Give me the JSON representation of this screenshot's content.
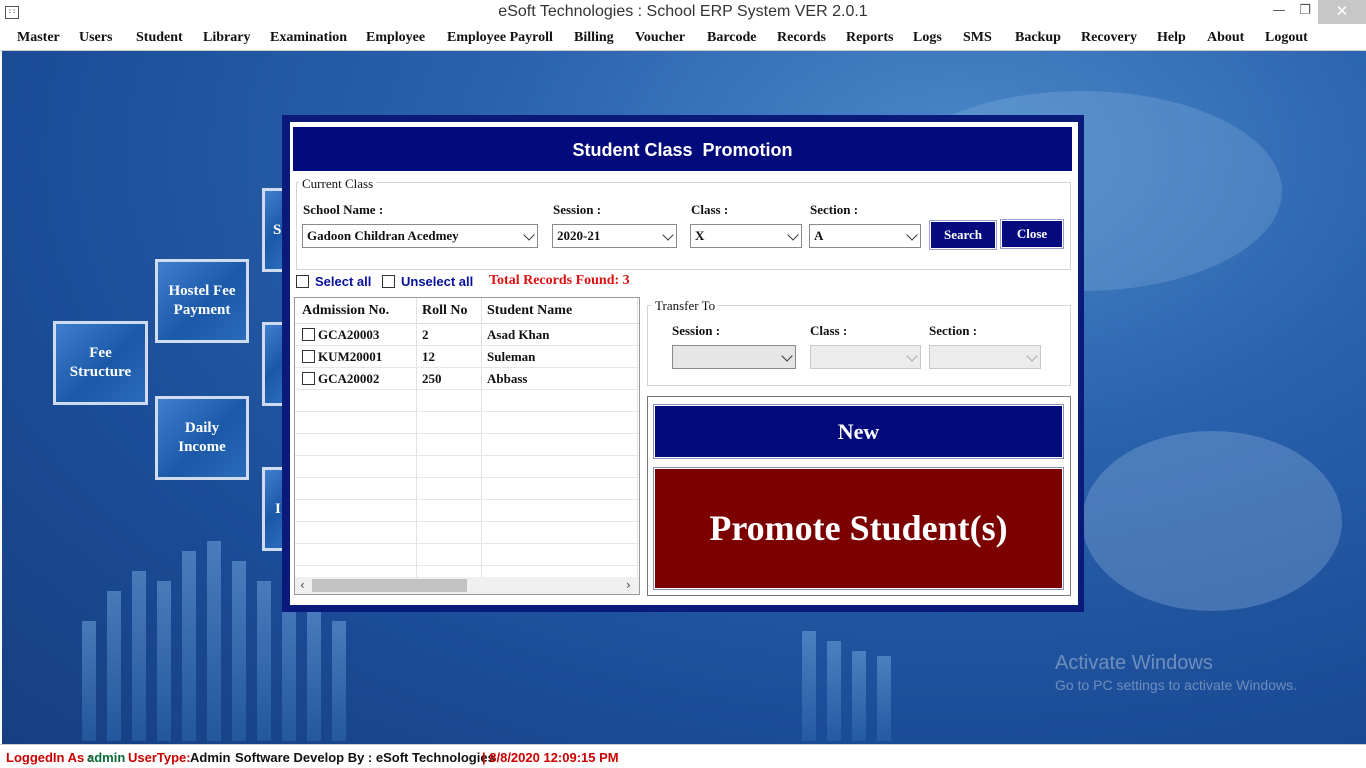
{
  "window": {
    "title": "eSoft Technologies : School ERP System VER 2.0.1",
    "icon": "app-icon",
    "min_glyph": "—",
    "max_glyph": "❐",
    "close_glyph": "✕"
  },
  "menu": [
    "Master",
    "Users",
    "Student",
    "Library",
    "Examination",
    "Employee",
    "Employee Payroll",
    "Billing",
    "Voucher",
    "Barcode",
    "Records",
    "Reports",
    "Logs",
    "SMS",
    "Backup",
    "Recovery",
    "Help",
    "About",
    "Logout"
  ],
  "tiles": {
    "hostel_fee": "Hostel Fee\nPayment",
    "fee_structure": "Fee\nStructure",
    "daily_income": "Daily\nIncome",
    "partial_1": "S",
    "partial_2": "I"
  },
  "dialog": {
    "title": "Student Class  Promotion",
    "current_class": {
      "legend": "Current Class",
      "school_label": "School Name :",
      "school_value": "Gadoon Childran Acedmey",
      "session_label": "Session :",
      "session_value": "2020-21",
      "class_label": "Class :",
      "class_value": "X",
      "section_label": "Section :",
      "section_value": "A",
      "search_label": "Search",
      "close_label": "Close"
    },
    "select_all": "Select all",
    "unselect_all": "Unselect all",
    "total_records": "Total Records Found: 3",
    "grid": {
      "columns": [
        "Admission No.",
        "Roll No",
        "Student Name"
      ],
      "rows": [
        {
          "admission": "GCA20003",
          "roll": "2",
          "name": "Asad Khan"
        },
        {
          "admission": "KUM20001",
          "roll": "12",
          "name": "Suleman"
        },
        {
          "admission": "GCA20002",
          "roll": "250",
          "name": "Abbass"
        }
      ],
      "scroll_left": "‹",
      "scroll_right": "›"
    },
    "transfer_to": {
      "legend": "Transfer To",
      "session_label": "Session :",
      "class_label": "Class :",
      "section_label": "Section :"
    },
    "new_label": "New",
    "promote_label": "Promote Student(s)"
  },
  "watermark": {
    "line1": "Activate Windows",
    "line2": "Go to PC settings to activate Windows."
  },
  "status": {
    "logged_label": "LoggedIn As :",
    "logged_value": "admin",
    "usertype_label": "UserType:",
    "usertype_value": "Admin",
    "developer": "Software Develop By : eSoft Technologies",
    "datetime": "| 8/8/2020 12:09:15 PM"
  },
  "colors": {
    "dialog_header": "#030a7c",
    "promote_button": "#7c0000",
    "total_records": "#dd1111",
    "links": "#06109a"
  }
}
